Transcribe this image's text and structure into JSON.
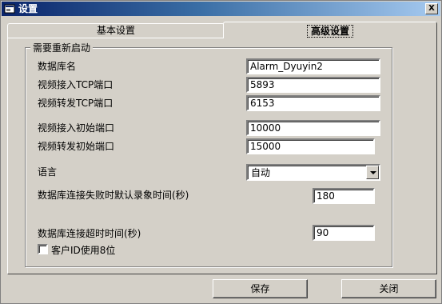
{
  "window": {
    "title": "设置",
    "close_label": "X"
  },
  "tabs": [
    {
      "label": "基本设置",
      "active": false
    },
    {
      "label": "高级设置",
      "active": true
    }
  ],
  "group": {
    "title": "需要重新启动",
    "fields": {
      "db_name": {
        "label": "数据库名",
        "value": "Alarm_Dyuyin2"
      },
      "video_in_tcp": {
        "label": "视频接入TCP端口",
        "value": "5893"
      },
      "video_fwd_tcp": {
        "label": "视频转发TCP端口",
        "value": "6153"
      },
      "video_in_start": {
        "label": "视频接入初始端口",
        "value": "10000"
      },
      "video_fwd_start": {
        "label": "视频转发初始端口",
        "value": "15000"
      },
      "language": {
        "label": "语言",
        "value": "自动"
      },
      "db_fail_record": {
        "label": "数据库连接失败时默认录象时间(秒)",
        "value": "180"
      },
      "db_timeout": {
        "label": "数据库连接超时时间(秒)",
        "value": "90"
      }
    },
    "checkbox": {
      "label": "客户ID使用8位",
      "checked": false
    }
  },
  "buttons": {
    "save": "保存",
    "close": "关闭"
  }
}
